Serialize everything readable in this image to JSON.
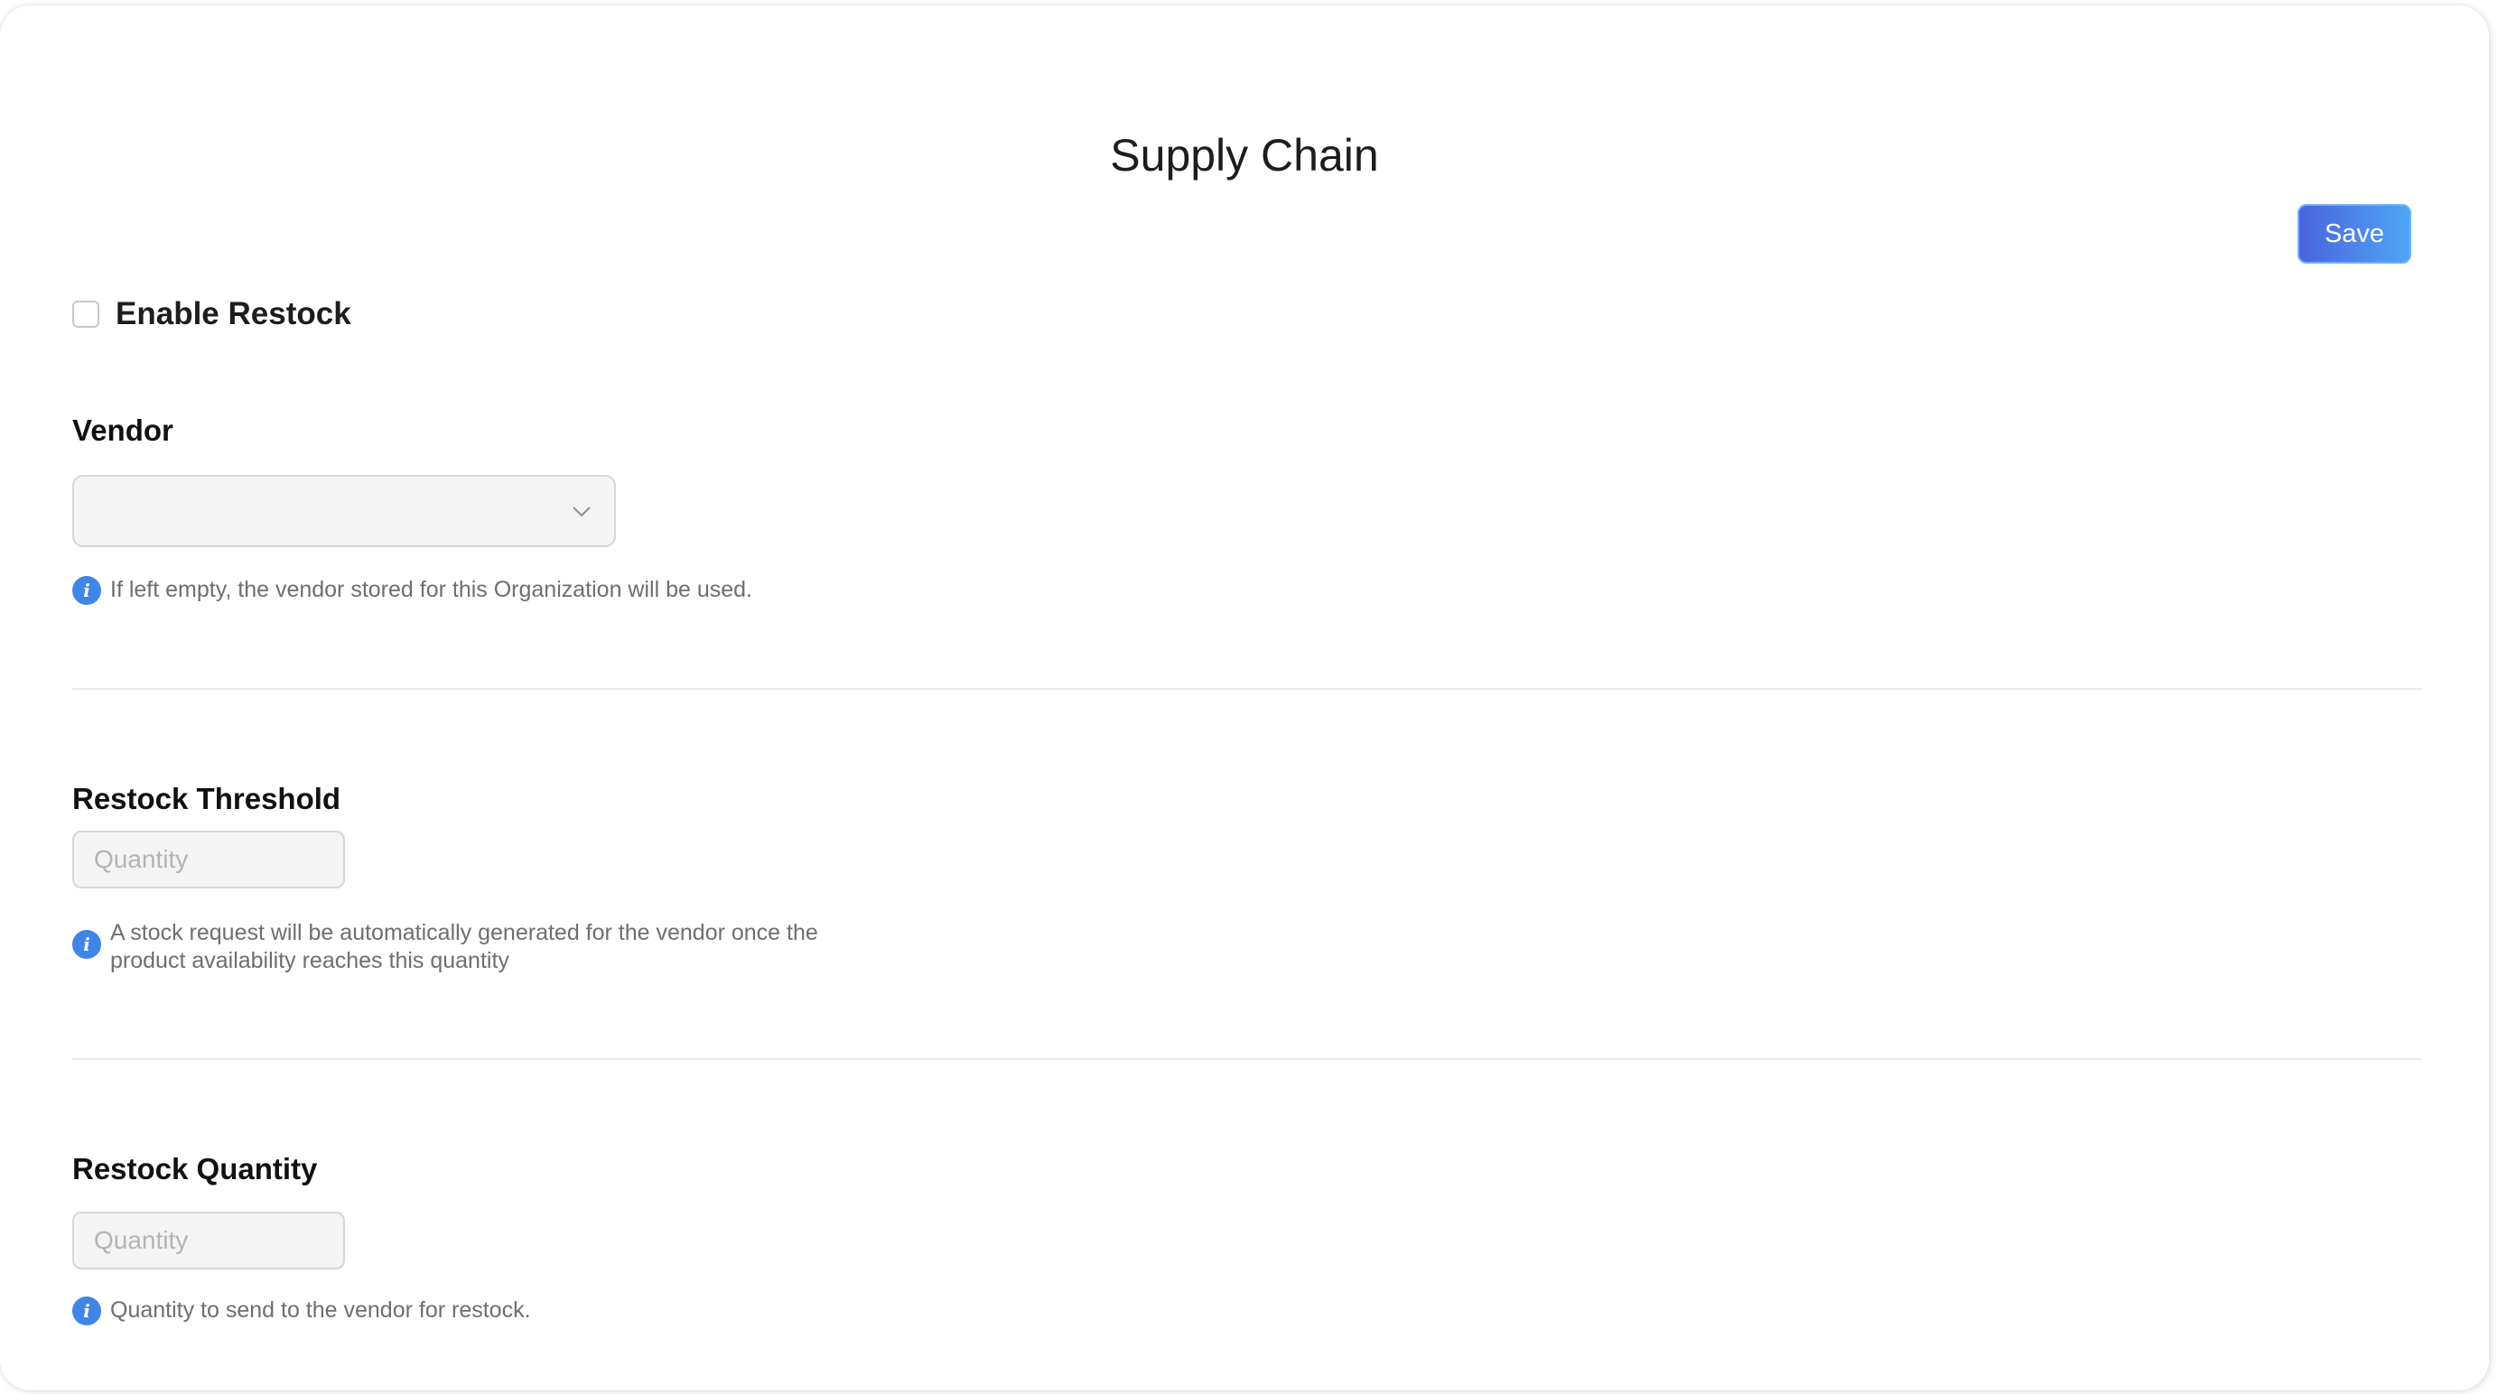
{
  "page": {
    "title": "Supply Chain"
  },
  "toolbar": {
    "save_label": "Save"
  },
  "enable_restock": {
    "label": "Enable Restock",
    "checked": false
  },
  "vendor": {
    "label": "Vendor",
    "value": "",
    "hint": "If left empty, the vendor stored for this Organization will be used."
  },
  "restock_threshold": {
    "label": "Restock Threshold",
    "placeholder": "Quantity",
    "value": "",
    "hint": "A stock request will be automatically generated for the vendor once the product availability reaches this quantity"
  },
  "restock_quantity": {
    "label": "Restock Quantity",
    "placeholder": "Quantity",
    "value": "",
    "hint": "Quantity to send to the vendor for restock."
  },
  "icons": {
    "info": "info-icon",
    "chevron": "chevron-down-icon"
  },
  "colors": {
    "accent_start": "#4a63dd",
    "accent_end": "#4ea6f5",
    "info": "#3f86e6"
  }
}
